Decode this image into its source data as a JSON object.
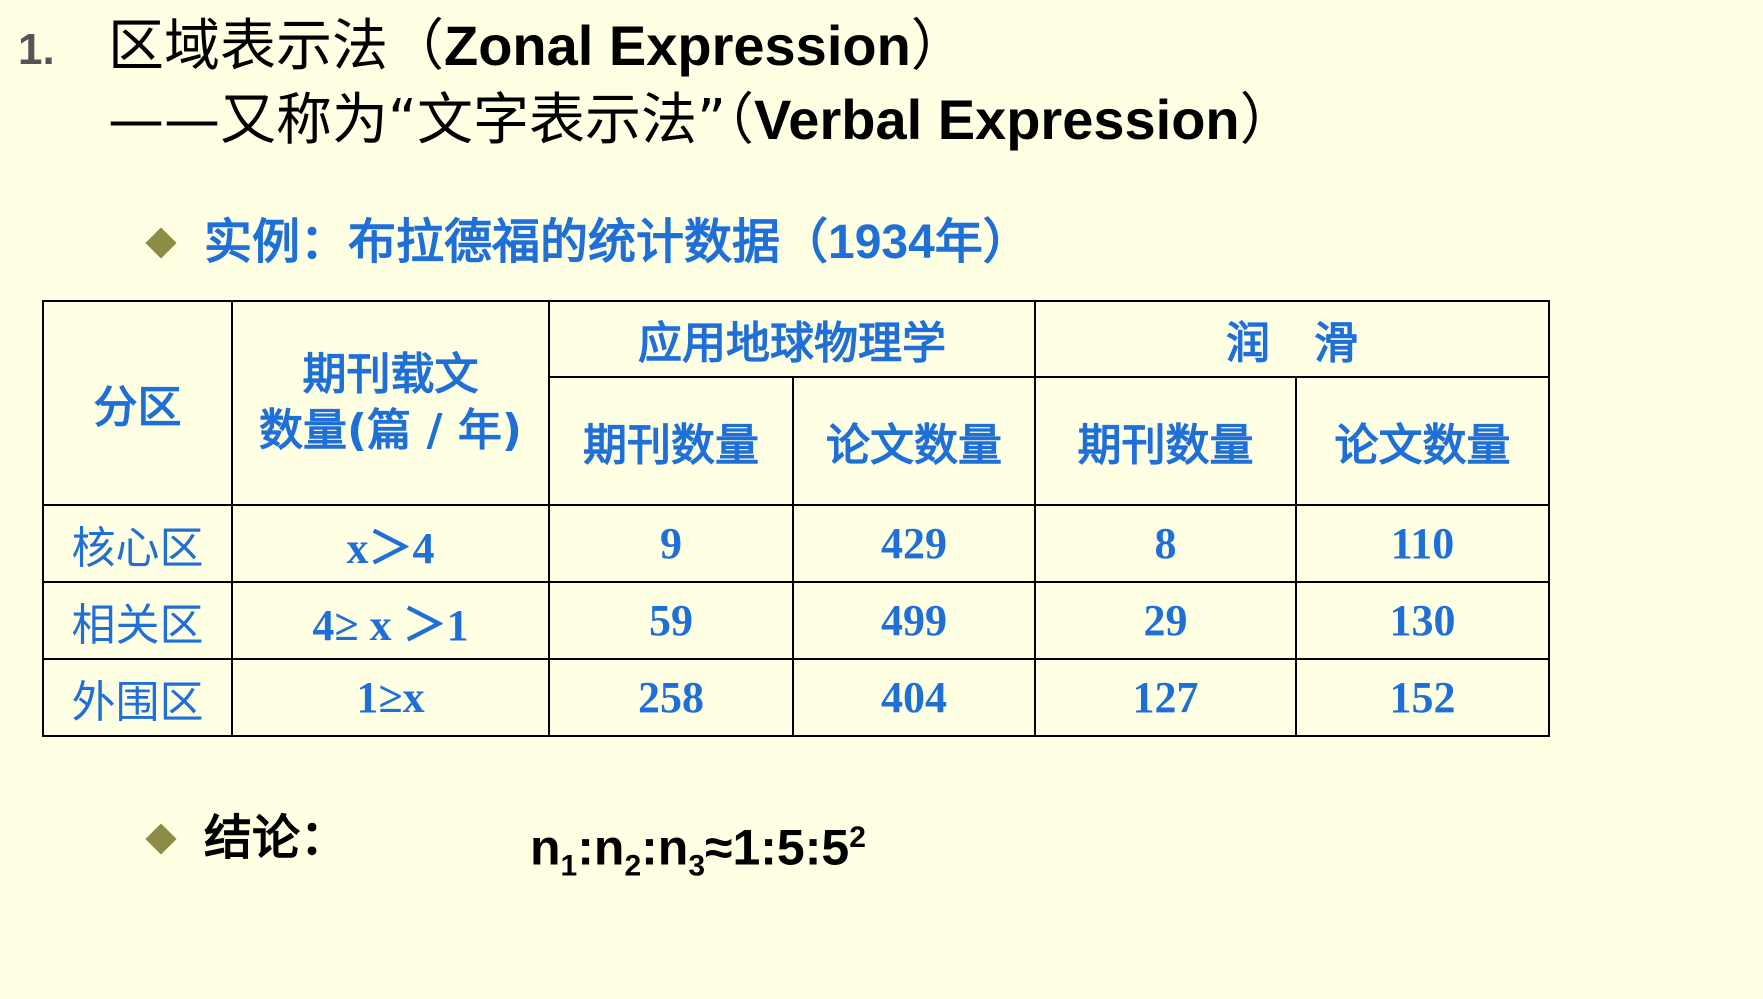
{
  "heading": {
    "number": "1.",
    "line1_cjk": "区域表示法（",
    "line1_latin": "Zonal Expression",
    "line1_close": "）",
    "line2_cjk": "——又称为“文字表示法”（",
    "line2_latin": "Verbal Expression",
    "line2_close": "）"
  },
  "example": {
    "text_cjk": "实例：布拉德福的统计数据（",
    "year": "1934",
    "text_tail": "年）"
  },
  "table": {
    "header_zone": "分区",
    "header_range_line1": "期刊载文",
    "header_range_line2": "数量(篇 / 年)",
    "group1": "应用地球物理学",
    "group2": "润　滑",
    "sub_journals": "期刊数量",
    "sub_papers": "论文数量",
    "rows": [
      {
        "zone": "核心区",
        "range": "x＞4",
        "g1_journals": "9",
        "g1_papers": "429",
        "g2_journals": "8",
        "g2_papers": "110"
      },
      {
        "zone": "相关区",
        "range": "4≥ x ＞1",
        "g1_journals": "59",
        "g1_papers": "499",
        "g2_journals": "29",
        "g2_papers": "130"
      },
      {
        "zone": "外围区",
        "range": "1≥x",
        "g1_journals": "258",
        "g1_papers": "404",
        "g2_journals": "127",
        "g2_papers": "152"
      }
    ]
  },
  "conclusion": {
    "label": "结论：",
    "n": "n",
    "sub1": "1",
    "sub2": "2",
    "sub3": "3",
    "colon": ":",
    "approx": "≈",
    "ratio_head": "1:5:5",
    "exponent": "2"
  },
  "colors": {
    "background": "#FFFFE3",
    "accent_blue": "#1F6FD9",
    "bullet_olive": "#8C8C44",
    "number_gray": "#555555"
  }
}
